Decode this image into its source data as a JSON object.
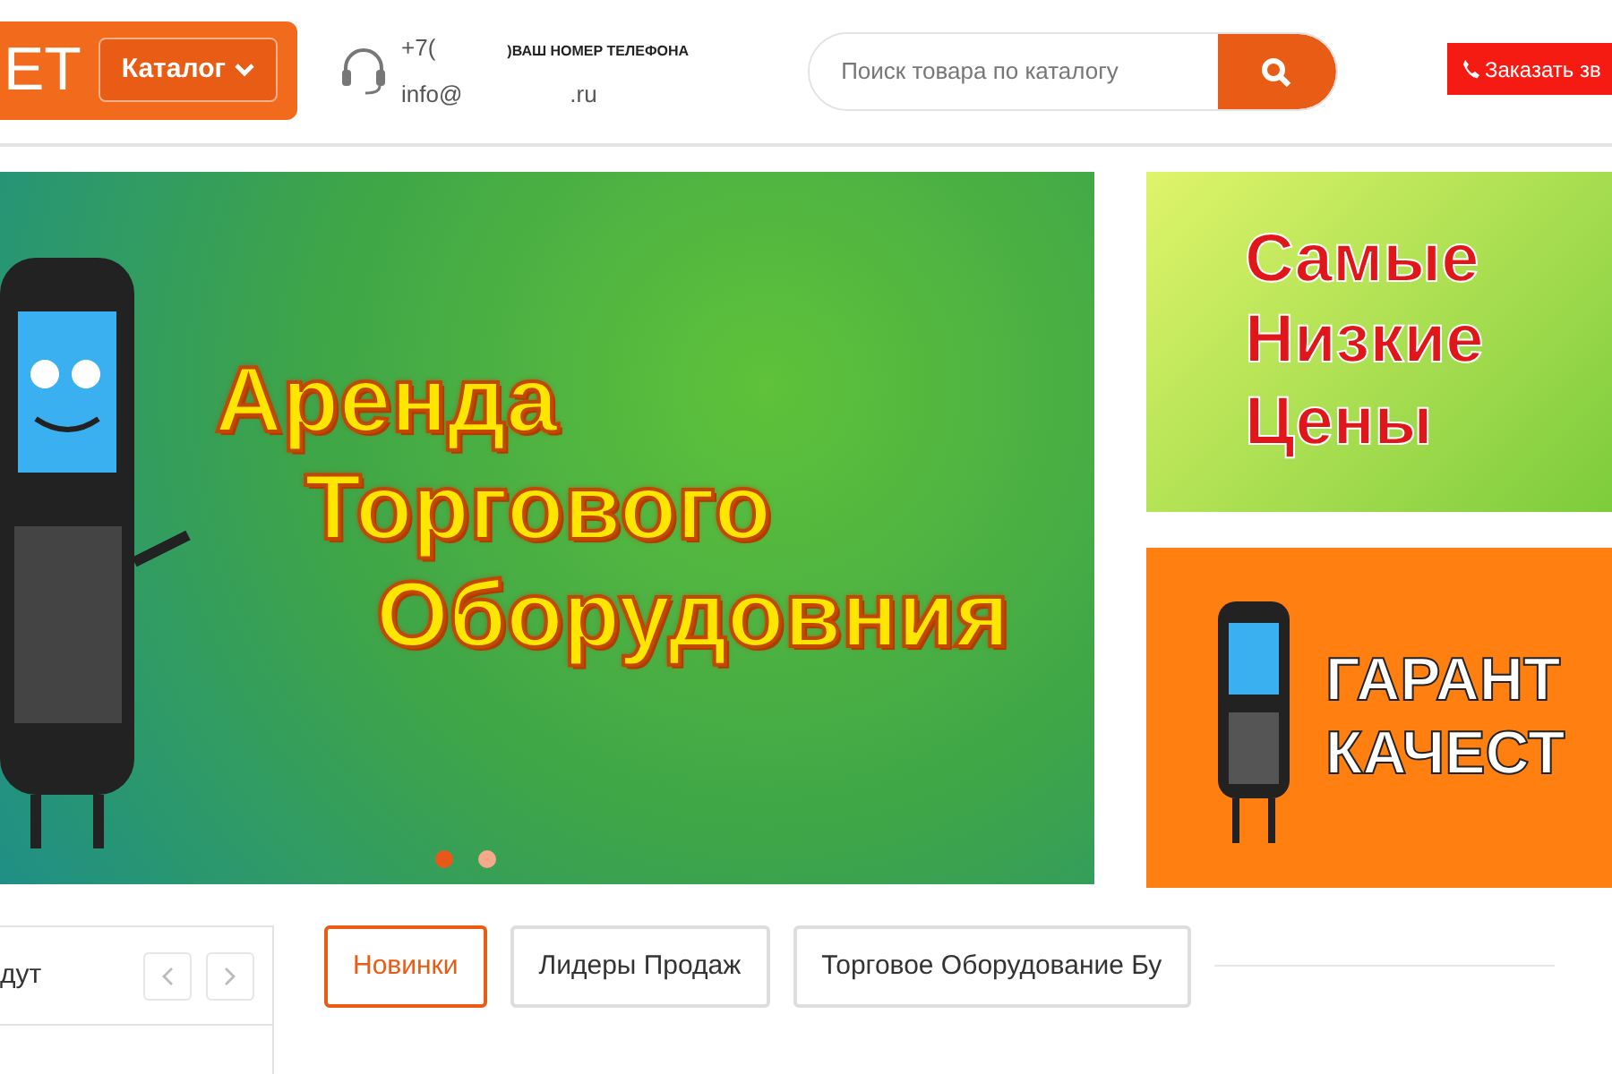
{
  "header": {
    "logo": "ET",
    "catalog_button": "Каталог",
    "phone": "+7(",
    "phone_note": ")ВАШ НОМЕР ТЕЛЕФОНА",
    "email_start": "info@",
    "email_end": ".ru",
    "search": {
      "placeholder": "Поиск товара по каталогу"
    },
    "callback_button": "Заказать зв"
  },
  "main_banner": {
    "lines": [
      "Аренда",
      "Торгового",
      "Оборудовния"
    ],
    "dots": [
      {
        "selected": true
      },
      {
        "selected": false
      }
    ]
  },
  "side_banners": [
    {
      "kind": "price",
      "lines": [
        "Самые",
        "Низкие",
        "Цены"
      ]
    },
    {
      "kind": "quality",
      "lines": [
        "ГАРАНТ",
        "КАЧЕСТ"
      ]
    }
  ],
  "sidebar_box": {
    "title": "дут"
  },
  "tabs": [
    {
      "label": "Новинки",
      "selected": true
    },
    {
      "label": "Лидеры Продаж",
      "selected": false
    },
    {
      "label": "Торговое Оборудование Бу",
      "selected": false
    }
  ]
}
